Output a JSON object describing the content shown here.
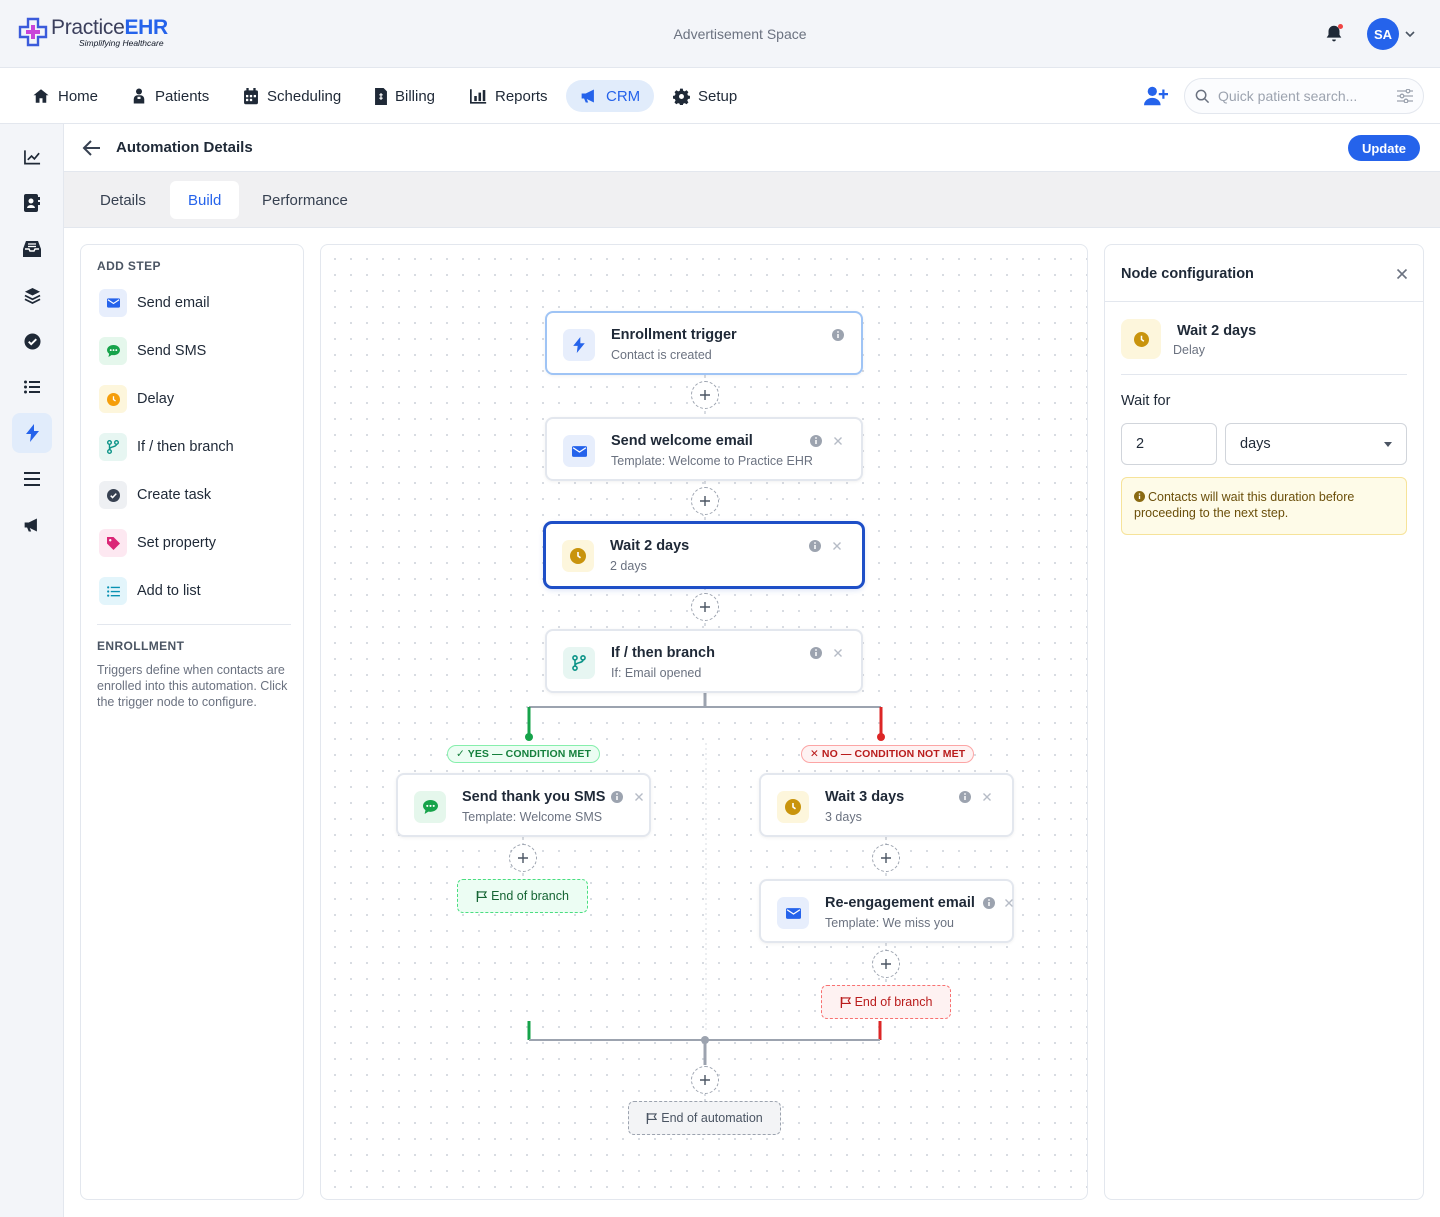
{
  "brand": {
    "name_part1": "Practice",
    "name_part2": "EHR",
    "tagline": "Simplifying Healthcare"
  },
  "topbar": {
    "ad_text": "Advertisement Space",
    "avatar_initials": "SA"
  },
  "nav": {
    "items": [
      {
        "label": "Home",
        "icon": "home-icon"
      },
      {
        "label": "Patients",
        "icon": "patient-icon"
      },
      {
        "label": "Scheduling",
        "icon": "calendar-icon"
      },
      {
        "label": "Billing",
        "icon": "invoice-icon"
      },
      {
        "label": "Reports",
        "icon": "chart-icon"
      },
      {
        "label": "CRM",
        "icon": "megaphone-icon",
        "active": true
      },
      {
        "label": "Setup",
        "icon": "gear-icon"
      }
    ],
    "search_placeholder": "Quick patient search..."
  },
  "rail": [
    "chart-line-icon",
    "contact-book-icon",
    "inbox-icon",
    "layers-icon",
    "check-circle-icon",
    "list-icon",
    "bolt-icon",
    "menu-icon",
    "megaphone-icon"
  ],
  "page": {
    "title": "Automation Details",
    "update_label": "Update"
  },
  "tabs": [
    {
      "label": "Details"
    },
    {
      "label": "Build",
      "active": true
    },
    {
      "label": "Performance"
    }
  ],
  "steps_panel": {
    "heading": "ADD STEP",
    "items": [
      {
        "label": "Send email",
        "icon": "envelope-icon"
      },
      {
        "label": "Send SMS",
        "icon": "sms-icon"
      },
      {
        "label": "Delay",
        "icon": "clock-icon"
      },
      {
        "label": "If / then branch",
        "icon": "branch-icon"
      },
      {
        "label": "Create task",
        "icon": "check-circle-icon"
      },
      {
        "label": "Set property",
        "icon": "tag-icon"
      },
      {
        "label": "Add to list",
        "icon": "list-icon"
      }
    ],
    "enroll_heading": "ENROLLMENT",
    "enroll_text": "Triggers define when contacts are enrolled into this automation. Click the trigger node to configure."
  },
  "flow": {
    "trigger": {
      "title": "Enrollment trigger",
      "sub": "Contact is created"
    },
    "email": {
      "title": "Send welcome email",
      "sub": "Template: Welcome to Practice EHR"
    },
    "wait": {
      "title": "Wait 2 days",
      "sub": "2 days"
    },
    "branch": {
      "title": "If / then branch",
      "sub": "If: Email opened"
    },
    "yes_label": "✓ YES — CONDITION MET",
    "no_label": "✕ NO — CONDITION NOT MET",
    "sms": {
      "title": "Send thank you SMS",
      "sub": "Template: Welcome SMS"
    },
    "wait3": {
      "title": "Wait 3 days",
      "sub": "3 days"
    },
    "reengage": {
      "title": "Re-engagement email",
      "sub": "Template: We miss you"
    },
    "end_branch": "End of branch",
    "end_automation": "End of automation"
  },
  "config": {
    "title": "Node configuration",
    "node_title": "Wait 2 days",
    "node_sub": "Delay",
    "wait_label": "Wait for",
    "wait_value": "2",
    "unit": "days",
    "note": "Contacts will wait this duration before proceeding to the next step."
  },
  "colors": {
    "accent": "#2563eb",
    "yes": "#16a34a",
    "no": "#dc2626",
    "delay": "#c9940d"
  }
}
